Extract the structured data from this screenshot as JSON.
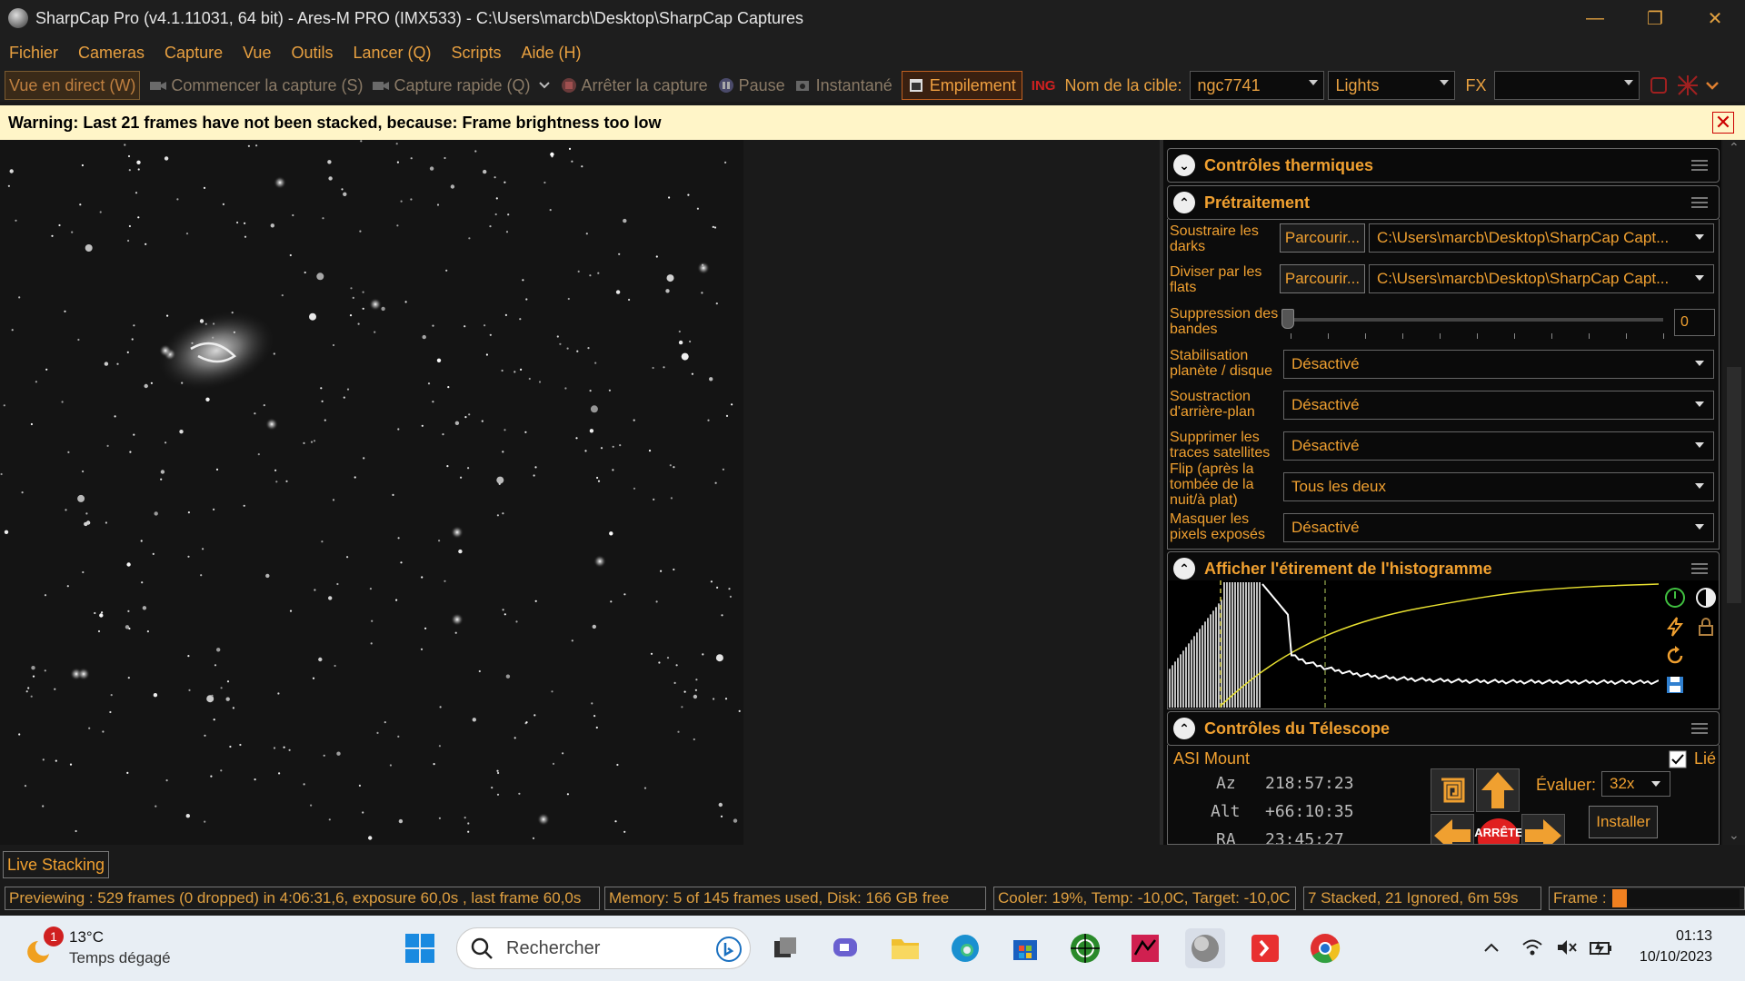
{
  "window": {
    "title": "SharpCap Pro (v4.1.11031, 64 bit) - Ares-M PRO (IMX533) - C:\\Users\\marcb\\Desktop\\SharpCap Captures",
    "minimize": "—",
    "restore": "❐",
    "close": "✕"
  },
  "menu": [
    "Fichier",
    "Cameras",
    "Capture",
    "Vue",
    "Outils",
    "Lancer (Q)",
    "Scripts",
    "Aide (H)"
  ],
  "toolbar": {
    "live_view": "Vue en direct (W)",
    "start_capture": "Commencer la capture (S)",
    "quick_capture": "Capture rapide (Q)",
    "stop_capture": "Arrêter la capture",
    "pause": "Pause",
    "snapshot": "Instantané",
    "stacking": "Empilement",
    "target_label": "Nom de la cible:",
    "target_value": "ngc7741",
    "frame_type": "Lights",
    "fx_label": "FX",
    "fx_value": ""
  },
  "warning": {
    "text": "Warning: Last 21 frames have not been stacked, because: Frame brightness too low",
    "close": "✕"
  },
  "panel": {
    "thermal": {
      "title": "Contrôles thermiques"
    },
    "preprocessing": {
      "title": "Prétraitement",
      "darks_label": "Soustraire les darks",
      "darks_btn": "Parcourir...",
      "darks_path": "C:\\Users\\marcb\\Desktop\\SharpCap Capt...",
      "flats_label": "Diviser par les flats",
      "flats_btn": "Parcourir...",
      "flats_path": "C:\\Users\\marcb\\Desktop\\SharpCap Capt...",
      "banding_label": "Suppression des bandes",
      "banding_value": "0",
      "stab_label": "Stabilisation planète / disque",
      "stab_value": "Désactivé",
      "bg_label": "Soustraction d'arrière-plan",
      "bg_value": "Désactivé",
      "sat_label": "Supprimer les traces satellites",
      "sat_value": "Désactivé",
      "flip_label": "Flip (après la tombée de la nuit/à plat)",
      "flip_value": "Tous les deux",
      "mask_label": "Masquer les pixels exposés",
      "mask_value": "Désactivé"
    },
    "histogram": {
      "title": "Afficher l'étirement de l'histogramme"
    },
    "telescope": {
      "title": "Contrôles du Télescope",
      "mount": "ASI Mount",
      "linked_label": "Lié",
      "az_label": "Az",
      "az_value": "218:57:23",
      "alt_label": "Alt",
      "alt_value": "+66:10:35",
      "ra_label": "RA",
      "ra_value": "23:45:27",
      "rate_label": "Évaluer:",
      "rate_value": "32x",
      "install_btn": "Installer",
      "stop_btn": "ARRÊTE"
    }
  },
  "bottom": {
    "live_stacking_tab": "Live Stacking",
    "status_preview": "Previewing : 529 frames (0 dropped) in 4:06:31,6, exposure 60,0s , last frame 60,0s",
    "status_memory": "Memory: 5 of 145 frames used, Disk: 166 GB free",
    "status_cooler": "Cooler: 19%, Temp: -10,0C, Target: -10,0C",
    "status_stack": "7 Stacked, 21 Ignored, 6m 59s",
    "status_frame": "Frame :",
    "frame_progress": 0.12
  },
  "taskbar": {
    "weather_temp": "13°C",
    "weather_desc": "Temps dégagé",
    "weather_badge": "1",
    "search_placeholder": "Rechercher",
    "time": "01:13",
    "date": "10/10/2023"
  },
  "colors": {
    "accent": "#f0a030",
    "warning_bg": "#fff5c8",
    "histogram_curve": "#e8e030"
  }
}
